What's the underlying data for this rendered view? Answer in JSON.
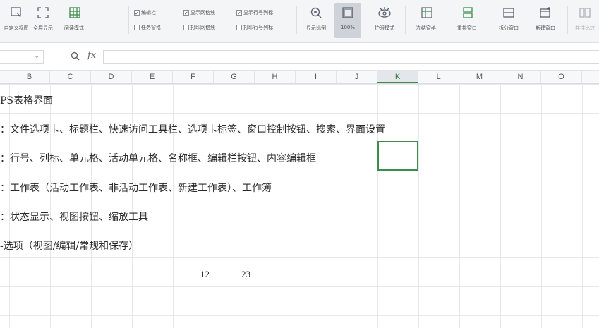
{
  "ribbon": {
    "buttons": [
      {
        "id": "custom-view",
        "label": "自定义视图",
        "icon": "custom-view-icon"
      },
      {
        "id": "fullscreen",
        "label": "全屏显示",
        "icon": "fullscreen-icon"
      },
      {
        "id": "reading-mode",
        "label": "阅读模式·",
        "icon": "reading-mode-icon"
      },
      {
        "id": "zoom",
        "label": "显示比例",
        "icon": "zoom-icon"
      },
      {
        "id": "zoom100",
        "label": "100%",
        "icon": "zoom-100-icon"
      },
      {
        "id": "eye-protection",
        "label": "护眼模式",
        "icon": "eye-protection-icon"
      },
      {
        "id": "freeze-panes",
        "label": "冻结窗格·",
        "icon": "freeze-panes-icon"
      },
      {
        "id": "rearrange-windows",
        "label": "重排窗口·",
        "icon": "rearrange-windows-icon"
      },
      {
        "id": "split-window",
        "label": "拆分窗口",
        "icon": "split-window-icon"
      },
      {
        "id": "new-window",
        "label": "新建窗口",
        "icon": "new-window-icon"
      },
      {
        "id": "side-by-side",
        "label": "并排比较",
        "icon": "side-by-side-icon"
      }
    ],
    "checkboxes": [
      {
        "label": "编辑栏",
        "checked": true
      },
      {
        "label": "任务窗格",
        "checked": false
      },
      {
        "label": "显示网格线",
        "checked": true
      },
      {
        "label": "打印网格线",
        "checked": false
      },
      {
        "label": "显示行号列标",
        "checked": true
      },
      {
        "label": "打印行号列标",
        "checked": false
      }
    ],
    "active_button": "zoom100"
  },
  "formula_bar": {
    "name_box": "",
    "fx_label": "fx",
    "content": ""
  },
  "columns": [
    "B",
    "C",
    "D",
    "E",
    "F",
    "G",
    "H",
    "I",
    "J",
    "K",
    "L",
    "M",
    "N",
    "O"
  ],
  "selected_column": "K",
  "rows": [
    "PS表格界面",
    "：文件选项卡、标题栏、快速访问工具栏、选项卡标签、窗口控制按钮、搜索、界面设置",
    "：行号、列标、单元格、活动单元格、名称框、编辑栏按钮、内容编辑框",
    "：工作表（活动工作表、非活动工作表、新建工作表）、工作簿",
    "：状态显示、视图按钮、缩放工具",
    "-选项（视图/编辑/常规和保存）"
  ],
  "numbers": {
    "f": "12",
    "g": "23"
  },
  "colors": {
    "accent": "#3d8c4b",
    "grid": "#e6e8eb",
    "ribbon_bg": "#f4f5f7"
  }
}
